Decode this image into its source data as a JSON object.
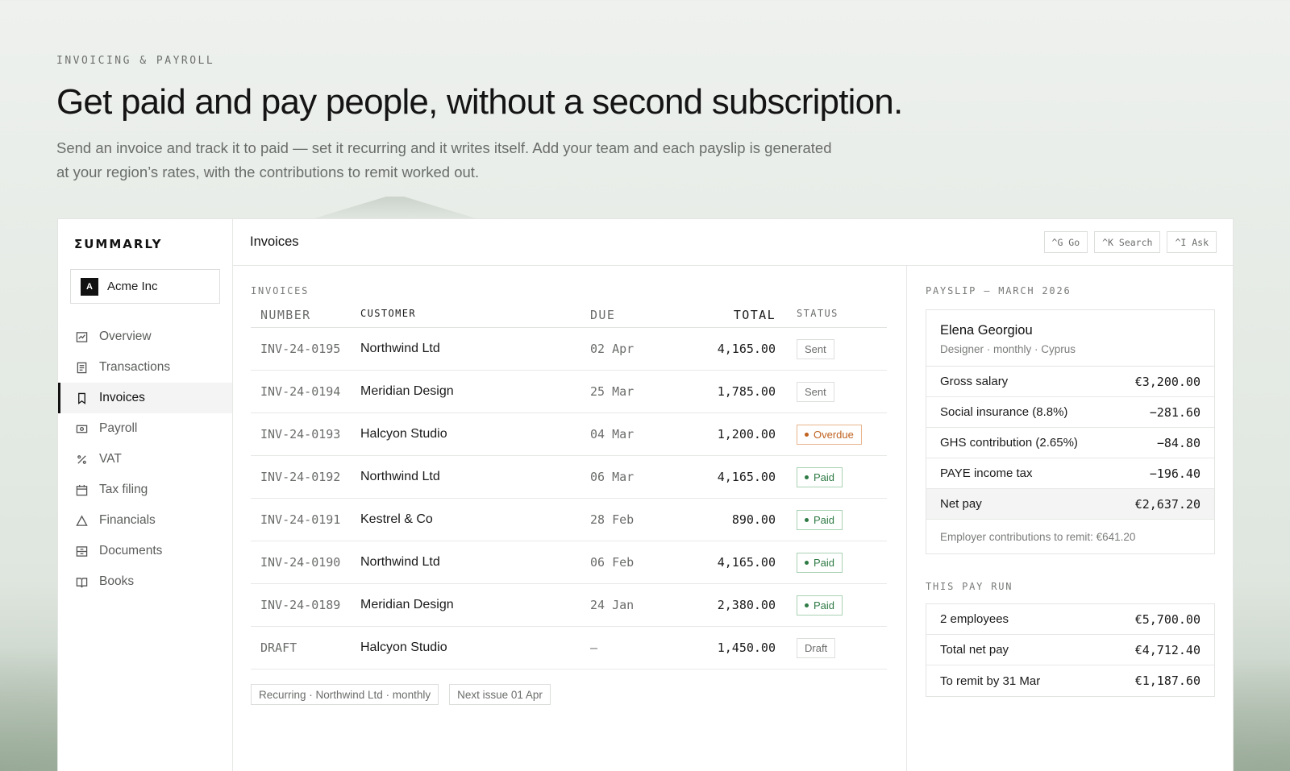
{
  "hero": {
    "eyebrow": "INVOICING & PAYROLL",
    "headline": "Get paid and pay people, without a second subscription.",
    "lede": "Send an invoice and track it to paid — set it recurring and it writes itself. Add your team and each payslip is generated at your region’s rates, with the contributions to remit worked out."
  },
  "sidebar": {
    "logo": "ΣUMMARLY",
    "org": {
      "badge": "A",
      "name": "Acme Inc"
    },
    "items": [
      {
        "label": "Overview",
        "icon": "chart-icon"
      },
      {
        "label": "Transactions",
        "icon": "receipt-icon"
      },
      {
        "label": "Invoices",
        "icon": "bookmark-icon",
        "active": true
      },
      {
        "label": "Payroll",
        "icon": "banknote-icon"
      },
      {
        "label": "VAT",
        "icon": "percent-icon"
      },
      {
        "label": "Tax filing",
        "icon": "calendar-icon"
      },
      {
        "label": "Financials",
        "icon": "triangle-icon"
      },
      {
        "label": "Documents",
        "icon": "archive-icon"
      },
      {
        "label": "Books",
        "icon": "book-icon"
      }
    ]
  },
  "topbar": {
    "title": "Invoices",
    "shortcuts": [
      "^G Go",
      "^K Search",
      "^I Ask"
    ]
  },
  "invoices": {
    "label": "INVOICES",
    "columns": [
      "NUMBER",
      "CUSTOMER",
      "DUE",
      "TOTAL",
      "STATUS"
    ],
    "rows": [
      {
        "number": "INV-24-0195",
        "customer": "Northwind Ltd",
        "due": "02 Apr",
        "total": "4,165.00",
        "status": "Sent"
      },
      {
        "number": "INV-24-0194",
        "customer": "Meridian Design",
        "due": "25 Mar",
        "total": "1,785.00",
        "status": "Sent"
      },
      {
        "number": "INV-24-0193",
        "customer": "Halcyon Studio",
        "due": "04 Mar",
        "total": "1,200.00",
        "status": "Overdue"
      },
      {
        "number": "INV-24-0192",
        "customer": "Northwind Ltd",
        "due": "06 Mar",
        "total": "4,165.00",
        "status": "Paid"
      },
      {
        "number": "INV-24-0191",
        "customer": "Kestrel & Co",
        "due": "28 Feb",
        "total": "890.00",
        "status": "Paid"
      },
      {
        "number": "INV-24-0190",
        "customer": "Northwind Ltd",
        "due": "06 Feb",
        "total": "4,165.00",
        "status": "Paid"
      },
      {
        "number": "INV-24-0189",
        "customer": "Meridian Design",
        "due": "24 Jan",
        "total": "2,380.00",
        "status": "Paid"
      },
      {
        "number": "DRAFT",
        "customer": "Halcyon Studio",
        "due": "—",
        "total": "1,450.00",
        "status": "Draft"
      }
    ],
    "chips": [
      "Recurring · Northwind Ltd · monthly",
      "Next issue 01 Apr"
    ]
  },
  "payslip": {
    "label": "PAYSLIP — MARCH 2026",
    "employee": {
      "name": "Elena Georgiou",
      "meta": "Designer · monthly · Cyprus"
    },
    "lines": [
      {
        "label": "Gross salary",
        "amount": "€3,200.00"
      },
      {
        "label": "Social insurance (8.8%)",
        "amount": "−281.60"
      },
      {
        "label": "GHS contribution (2.65%)",
        "amount": "−84.80"
      },
      {
        "label": "PAYE income tax",
        "amount": "−196.40"
      }
    ],
    "net": {
      "label": "Net pay",
      "amount": "€2,637.20"
    },
    "note": "Employer contributions to remit: €641.20"
  },
  "payrun": {
    "label": "THIS PAY RUN",
    "lines": [
      {
        "label": "2 employees",
        "amount": "€5,700.00"
      },
      {
        "label": "Total net pay",
        "amount": "€4,712.40"
      },
      {
        "label": "To remit by 31 Mar",
        "amount": "€1,187.60"
      }
    ]
  },
  "colors": {
    "paid": "#2e7a44",
    "overdue": "#c0621f",
    "accent": "#111111"
  }
}
